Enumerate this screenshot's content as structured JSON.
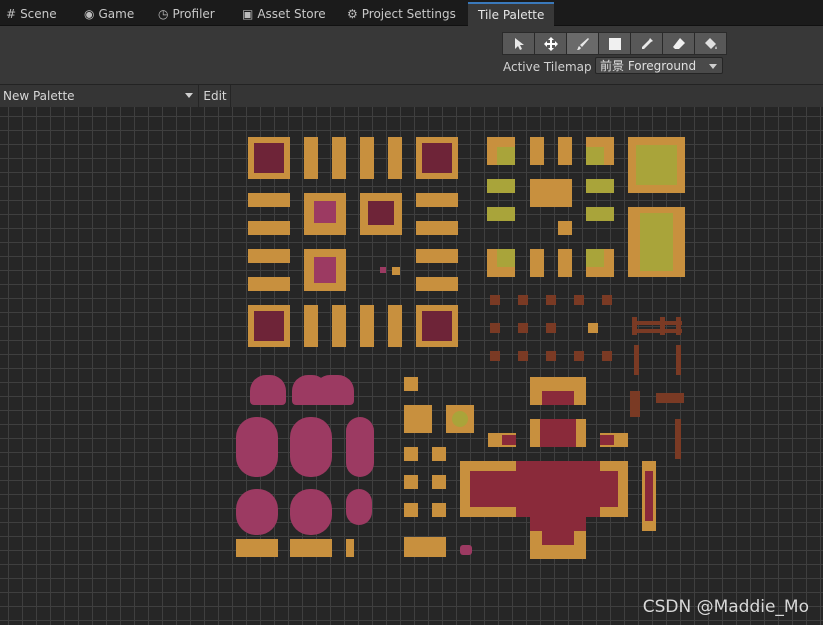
{
  "tabs": [
    {
      "label": "Scene",
      "icon": "grid-icon"
    },
    {
      "label": "Game",
      "icon": "gamepad-icon"
    },
    {
      "label": "Profiler",
      "icon": "stopwatch-icon"
    },
    {
      "label": "Asset Store",
      "icon": "bag-icon"
    },
    {
      "label": "Project Settings",
      "icon": "gear-icon"
    },
    {
      "label": "Tile Palette",
      "icon": ""
    }
  ],
  "toolbar": {
    "tools": [
      "select-tool",
      "move-tool",
      "paint-brush-tool",
      "box-fill-tool",
      "pick-tool",
      "erase-tool",
      "flood-fill-tool"
    ],
    "active_tilemap_label": "Active Tilemap",
    "active_tilemap_value": "前景 Foreground"
  },
  "palette": {
    "selected": "New Palette",
    "edit_label": "Edit"
  },
  "watermark": "CSDN @Maddie_Mo"
}
